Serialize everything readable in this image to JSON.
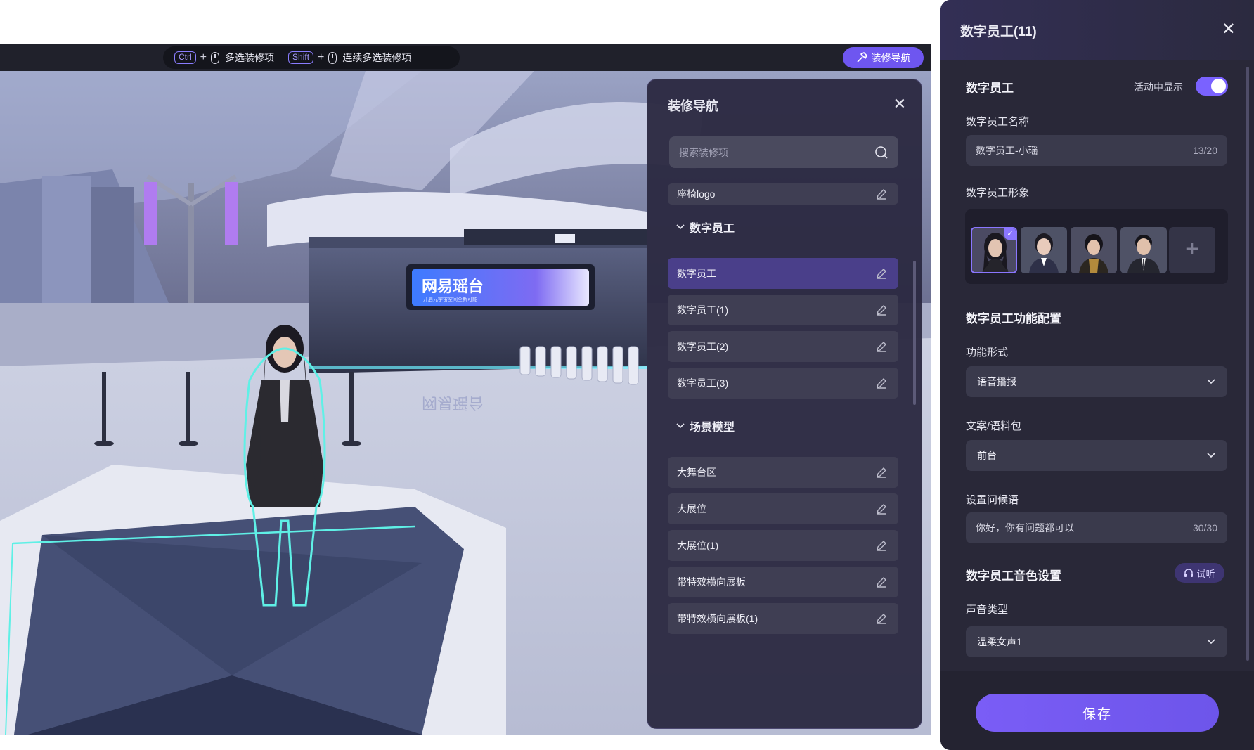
{
  "viewport": {
    "shortcuts": [
      {
        "key": "Ctrl",
        "plus": "+",
        "text": "多选装修项"
      },
      {
        "key": "Shift",
        "plus": "+",
        "text": "连续多选装修项"
      }
    ],
    "nav_button_label": "装修导航",
    "sign_text": "网易瑶台",
    "sign_subtext": "开启元宇宙空间全新可能",
    "floor_reflection_text": "网易瑶台"
  },
  "nav_panel": {
    "title": "装修导航",
    "close_icon": "close-icon",
    "search_placeholder": "搜索装修项",
    "partial_item": "座椅logo",
    "groups": [
      {
        "name": "数字员工",
        "items": [
          "数字员工",
          "数字员工(1)",
          "数字员工(2)",
          "数字员工(3)"
        ],
        "active_index": 0
      },
      {
        "name": "场景模型",
        "items": [
          "大舞台区",
          "大展位",
          "大展位(1)",
          "带特效横向展板",
          "带特效横向展板(1)"
        ]
      }
    ]
  },
  "settings": {
    "title": "数字员工(11)",
    "section_title": "数字员工",
    "show_in_event_label": "活动中显示",
    "show_in_event": true,
    "name_label": "数字员工名称",
    "name_value": "数字员工-小瑶",
    "name_count": "13/20",
    "image_label": "数字员工形象",
    "avatar_count": 4,
    "selected_avatar": 0,
    "function_config_title": "数字员工功能配置",
    "function_mode_label": "功能形式",
    "function_mode_value": "语音播报",
    "script_pack_label": "文案/语料包",
    "script_pack_value": "前台",
    "greeting_label": "设置问候语",
    "greeting_value": "你好，你有问题都可以",
    "greeting_count": "30/30",
    "voice_title": "数字员工音色设置",
    "listen_label": "试听",
    "voice_type_label": "声音类型",
    "voice_type_value": "温柔女声1",
    "save_label": "保存"
  },
  "colors": {
    "accent": "#7a62ff",
    "panel_bg": "#292838",
    "nav_bg": "#2c2a42",
    "selection_outline": "#5ff0e6"
  }
}
